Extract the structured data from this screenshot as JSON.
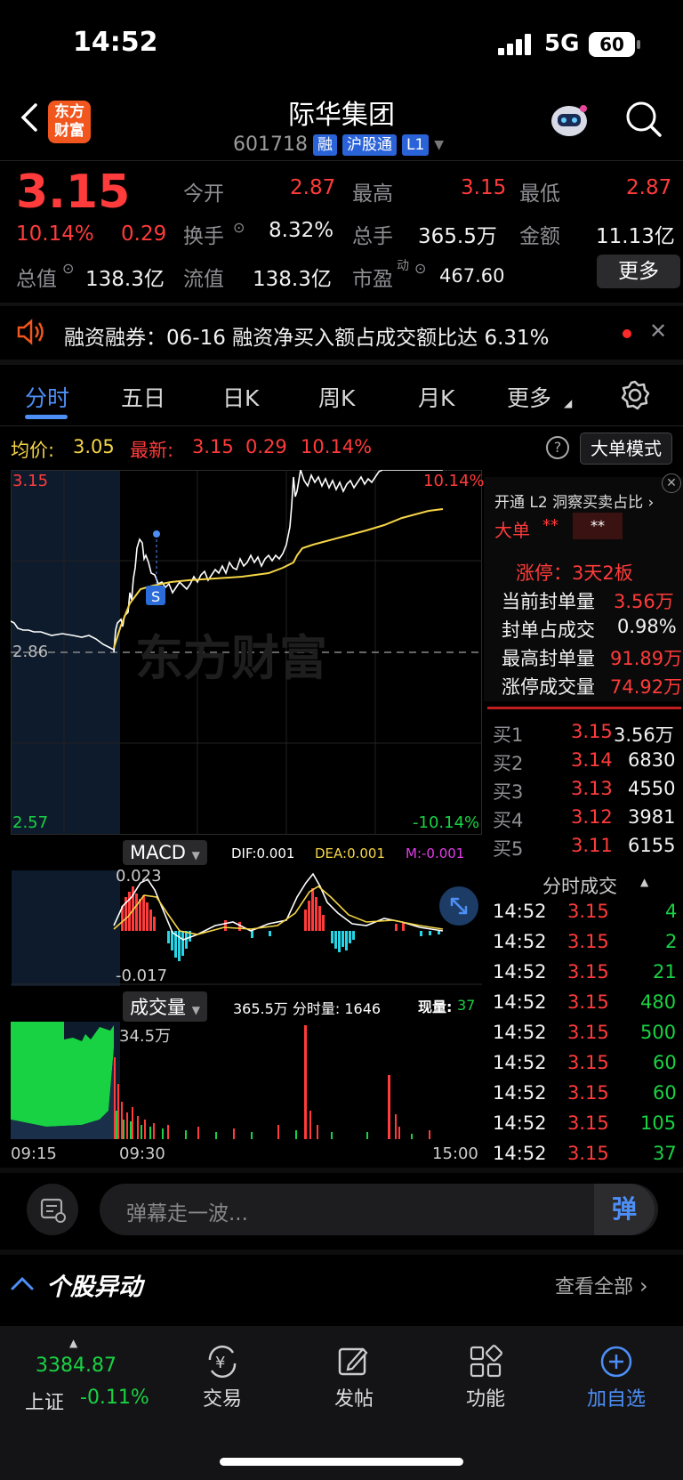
{
  "status": {
    "time": "14:52",
    "network": "5G",
    "battery": "60"
  },
  "header": {
    "title": "际华集团",
    "code": "601718",
    "tags": [
      "融",
      "沪股通",
      "L1"
    ],
    "logo": "东方财富"
  },
  "quote": {
    "price": "3.15",
    "change_pct": "10.14%",
    "change": "0.29",
    "stats": [
      {
        "label": "今开",
        "value": "2.87"
      },
      {
        "label": "最高",
        "value": "3.15"
      },
      {
        "label": "最低",
        "value": "2.87"
      },
      {
        "label": "换手",
        "value": "8.32%"
      },
      {
        "label": "总手",
        "value": "365.5万"
      },
      {
        "label": "金额",
        "value": "11.13亿"
      },
      {
        "label": "总值",
        "value": "138.3亿"
      },
      {
        "label": "流值",
        "value": "138.3亿"
      },
      {
        "label": "市盈",
        "sup": "动",
        "value": "467.60"
      }
    ],
    "more": "更多"
  },
  "notice": {
    "text": "融资融券：06-16 融资净买入额占成交额比达 6.31%"
  },
  "tabs": [
    "分时",
    "五日",
    "日K",
    "周K",
    "月K",
    "更多"
  ],
  "info": {
    "avg_label": "均价:",
    "avg": "3.05",
    "latest_label": "最新:",
    "latest": "3.15",
    "chg": "0.29",
    "pct": "10.14%",
    "mode_button": "大单模式"
  },
  "chart": {
    "price_high": "3.15",
    "price_mid": "2.86",
    "price_low": "2.57",
    "pct_high": "10.14%",
    "pct_low": "-10.14%",
    "watermark": "东方财富",
    "marker": "S",
    "macd": {
      "label": "MACD",
      "dif": "DIF:0.001",
      "dea": "DEA:0.001",
      "m": "M:-0.001",
      "top": "0.023",
      "bottom": "-0.017"
    },
    "volume": {
      "label": "成交量",
      "summary": "365.5万 分时量: 1646",
      "now_label": "现量:",
      "now": "37",
      "max": "34.5万"
    },
    "times": [
      "09:15",
      "09:30",
      "15:00"
    ]
  },
  "chart_data": {
    "type": "line",
    "series": [
      {
        "name": "均价",
        "values": [
          2.87,
          2.92,
          2.95,
          2.96,
          2.97,
          3.0,
          3.04,
          3.05
        ]
      }
    ],
    "ylim": [
      2.57,
      3.15
    ]
  },
  "panel": {
    "l2": "开通 L2 洞察买卖占比",
    "big_label": "大单",
    "big_value1": "**",
    "big_value2": "**",
    "limit_title": "涨停：3天2板",
    "limit_rows": [
      {
        "label": "当前封单量",
        "value": "3.56万"
      },
      {
        "label": "封单占成交",
        "value": "0.98%"
      },
      {
        "label": "最高封单量",
        "value": "91.89万"
      },
      {
        "label": "涨停成交量",
        "value": "74.92万"
      }
    ],
    "bids": [
      {
        "label": "买1",
        "price": "3.15",
        "qty": "3.56万"
      },
      {
        "label": "买2",
        "price": "3.14",
        "qty": "6830"
      },
      {
        "label": "买3",
        "price": "3.13",
        "qty": "4550"
      },
      {
        "label": "买4",
        "price": "3.12",
        "qty": "3981"
      },
      {
        "label": "买5",
        "price": "3.11",
        "qty": "6155"
      }
    ],
    "trades_title": "分时成交",
    "trades": [
      {
        "t": "14:52",
        "p": "3.15",
        "v": "4"
      },
      {
        "t": "14:52",
        "p": "3.15",
        "v": "2"
      },
      {
        "t": "14:52",
        "p": "3.15",
        "v": "21"
      },
      {
        "t": "14:52",
        "p": "3.15",
        "v": "480"
      },
      {
        "t": "14:52",
        "p": "3.15",
        "v": "500"
      },
      {
        "t": "14:52",
        "p": "3.15",
        "v": "60"
      },
      {
        "t": "14:52",
        "p": "3.15",
        "v": "60"
      },
      {
        "t": "14:52",
        "p": "3.15",
        "v": "105"
      },
      {
        "t": "14:52",
        "p": "3.15",
        "v": "37"
      }
    ]
  },
  "danmu": {
    "placeholder": "弹幕走一波...",
    "button": "弹"
  },
  "section": {
    "title": "个股异动",
    "link": "查看全部"
  },
  "bottom": {
    "index_value": "3384.87",
    "index_name": "上证",
    "index_chg": "-0.11%",
    "items": [
      "交易",
      "发帖",
      "功能",
      "加自选"
    ]
  }
}
